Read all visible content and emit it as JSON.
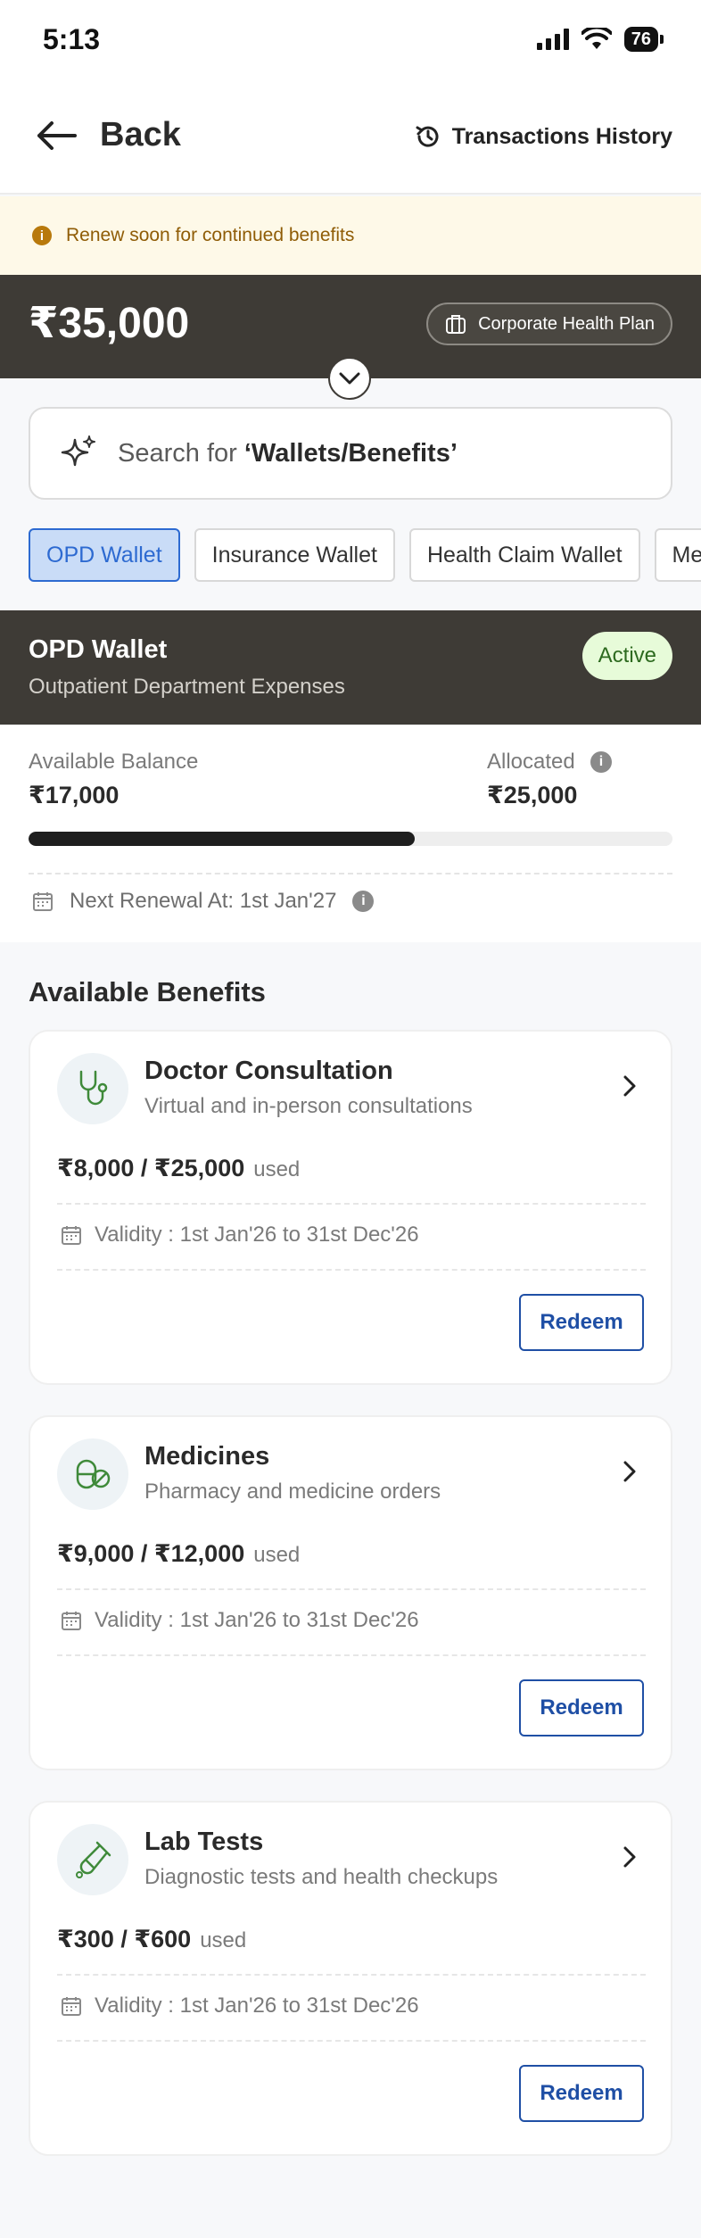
{
  "status_bar": {
    "time": "5:13",
    "battery": "76"
  },
  "header": {
    "back_label": "Back",
    "history_label": "Transactions History"
  },
  "banner": {
    "text": "Renew soon for continued benefits"
  },
  "balance": {
    "amount": "₹35,000",
    "plan_label": "Corporate Health Plan"
  },
  "search": {
    "prefix": "Search for ",
    "quoted": "‘Wallets/Benefits’"
  },
  "tabs": [
    "OPD Wallet",
    "Insurance Wallet",
    "Health Claim Wallet",
    "Medicines Wallet"
  ],
  "wallet": {
    "title": "OPD Wallet",
    "subtitle": "Outpatient Department Expenses",
    "status": "Active",
    "available_label": "Available Balance",
    "available_value": "₹17,000",
    "allocated_label": "Allocated",
    "allocated_value": "₹25,000",
    "used_fraction": 0.6,
    "renewal_text": "Next Renewal At: 1st Jan'27"
  },
  "benefits_heading": "Available Benefits",
  "benefits": [
    {
      "title": "Doctor Consultation",
      "subtitle": "Virtual and in-person consultations",
      "amount": "₹8,000 / ₹25,000",
      "used_label": "used",
      "validity": "Validity : 1st Jan'26 to 31st Dec'26",
      "redeem_label": "Redeem",
      "icon": "stethoscope-icon"
    },
    {
      "title": "Medicines",
      "subtitle": "Pharmacy and medicine orders",
      "amount": "₹9,000 / ₹12,000",
      "used_label": "used",
      "validity": "Validity : 1st Jan'26 to 31st Dec'26",
      "redeem_label": "Redeem",
      "icon": "pill-icon"
    },
    {
      "title": "Lab Tests",
      "subtitle": "Diagnostic tests and health checkups",
      "amount": "₹300 / ₹600",
      "used_label": "used",
      "validity": "Validity : 1st Jan'26 to 31st Dec'26",
      "redeem_label": "Redeem",
      "icon": "test-tube-icon"
    }
  ],
  "colors": {
    "accent_blue": "#2d6ad1",
    "dark_band": "#3e3b36",
    "active_green": "#e7fbd9",
    "icon_green": "#3f8a3a"
  }
}
